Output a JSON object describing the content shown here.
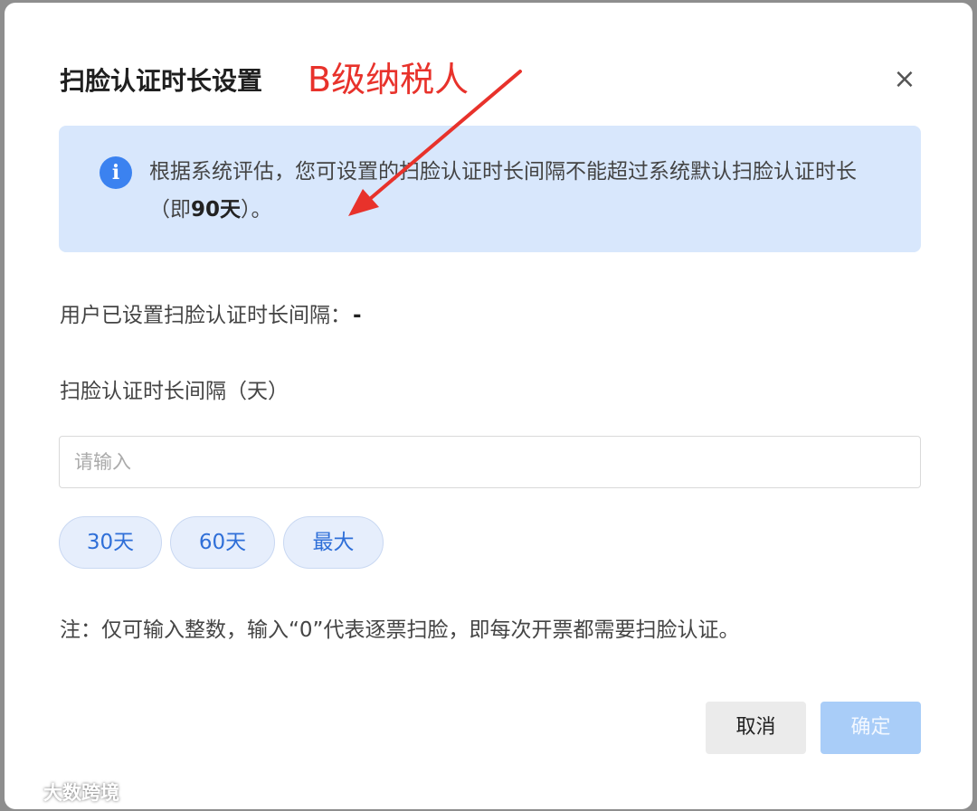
{
  "dialog": {
    "title": "扫脸认证时长设置",
    "annotation": "B级纳税人",
    "close_symbol": "×"
  },
  "info": {
    "icon_glyph": "i",
    "text_before": "根据系统评估，您可设置的扫脸认证时长间隔不能超过系统默认扫脸认证时长（即",
    "highlight": "90天",
    "text_after": "）。"
  },
  "current": {
    "label": "用户已设置扫脸认证时长间隔：",
    "value": "-"
  },
  "field": {
    "label": "扫脸认证时长间隔（天）",
    "placeholder": "请输入",
    "value": ""
  },
  "presets": [
    {
      "label": "30天"
    },
    {
      "label": "60天"
    },
    {
      "label": "最大"
    }
  ],
  "note": "注：仅可输入整数，输入“0”代表逐票扫脸，即每次开票都需要扫脸认证。",
  "buttons": {
    "cancel": "取消",
    "confirm": "确定"
  },
  "watermark": {
    "text": "大数跨境"
  },
  "colors": {
    "annotation": "#e8322b",
    "info_bg": "#d8e7fc",
    "info_icon": "#3b82f0",
    "chip_text": "#2f6fd8",
    "confirm_disabled": "#a9cdf8"
  }
}
